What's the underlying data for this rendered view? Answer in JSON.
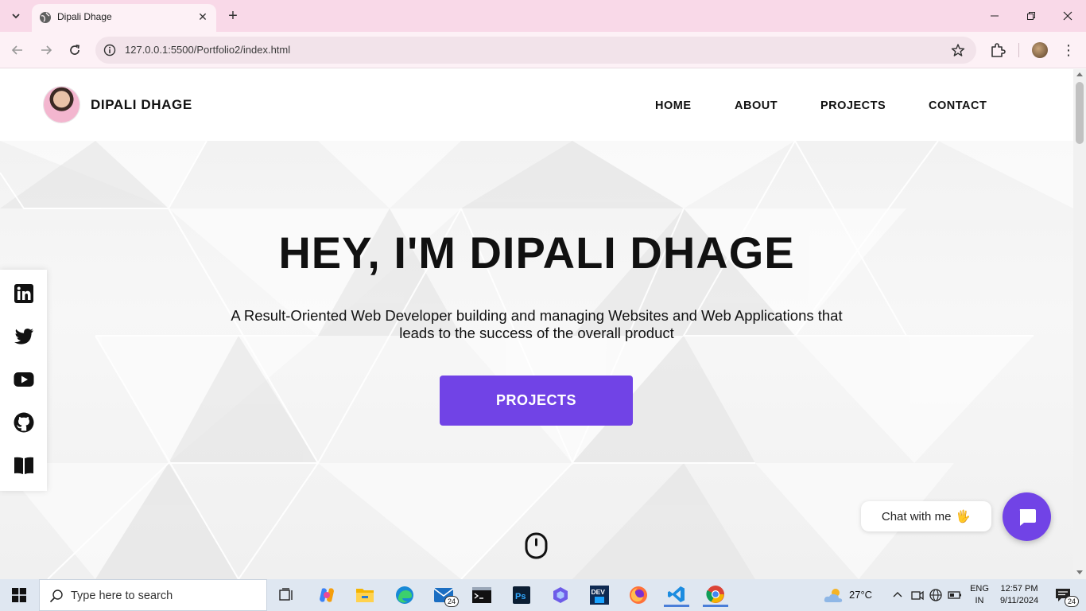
{
  "browser": {
    "tab_title": "Dipali Dhage",
    "url": "127.0.0.1:5500/Portfolio2/index.html",
    "icons": [
      "tab-search-icon",
      "globe-icon",
      "close-icon",
      "plus-icon",
      "minimize-icon",
      "restore-icon",
      "close-window-icon",
      "back-icon",
      "forward-icon",
      "reload-icon",
      "site-info-icon",
      "star-icon",
      "extensions-icon",
      "profile-avatar",
      "kebab-menu-icon"
    ]
  },
  "site": {
    "brand": "DIPALI DHAGE",
    "nav": [
      "HOME",
      "ABOUT",
      "PROJECTS",
      "CONTACT"
    ],
    "hero_title": "HEY, I'M DIPALI DHAGE",
    "hero_subtitle": "A Result-Oriented Web Developer building and managing Websites and Web Applications that leads to the success of the overall product",
    "hero_button": "PROJECTS",
    "social": [
      "linkedin-icon",
      "twitter-icon",
      "youtube-icon",
      "github-icon",
      "book-icon"
    ],
    "chat_label": "Chat with me",
    "chat_emoji": "🖐",
    "accent": "#7143e6"
  },
  "taskbar": {
    "search_placeholder": "Type here to search",
    "apps": [
      "task-view-icon",
      "copilot-icon",
      "file-explorer-icon",
      "edge-icon",
      "mail-icon",
      "terminal-icon",
      "photoshop-icon",
      "app-icon",
      "dev-icon",
      "firefox-icon",
      "vscode-icon",
      "chrome-icon"
    ],
    "mail_badge": "24",
    "weather": "27°C",
    "lang_top": "ENG",
    "lang_bottom": "IN",
    "time": "12:57 PM",
    "date": "9/11/2024",
    "notif_badge": "24"
  }
}
